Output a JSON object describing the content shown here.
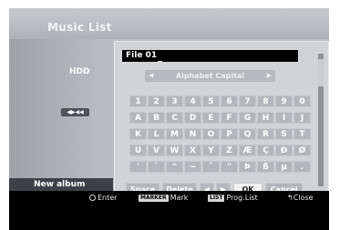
{
  "window": {
    "title": "Music List"
  },
  "sidebar": {
    "drive_label": "HDD",
    "icon_text": "◀▶◀◀",
    "new_album_label": "New album"
  },
  "dialog": {
    "file_name": "File 01",
    "charset_label": "Alphabet Capital",
    "charset_prev": "◀",
    "charset_next": "▶",
    "rows": [
      [
        "1",
        "2",
        "3",
        "4",
        "5",
        "6",
        "7",
        "8",
        "9",
        "0"
      ],
      [
        "A",
        "B",
        "C",
        "D",
        "E",
        "F",
        "G",
        "H",
        "I",
        "J"
      ],
      [
        "K",
        "L",
        "M",
        "N",
        "O",
        "P",
        "Q",
        "R",
        "S",
        "T"
      ],
      [
        "U",
        "V",
        "W",
        "X",
        "Y",
        "Z",
        "Æ",
        "Ç",
        "Ð",
        "Ø"
      ],
      [
        "'",
        "`",
        "^",
        "~",
        "¨",
        "\"",
        "Þ",
        "ß",
        "µ",
        "."
      ]
    ],
    "buttons": {
      "space": "Space",
      "delete": "Delete",
      "left": "◀",
      "right": "▶",
      "ok": "OK",
      "cancel": "Cancel"
    }
  },
  "footer": {
    "enter": "Enter",
    "marker_badge": "MARKER",
    "mark": "Mark",
    "list_badge": "LIST",
    "prog_list": "Prog.List",
    "close": "Close"
  }
}
